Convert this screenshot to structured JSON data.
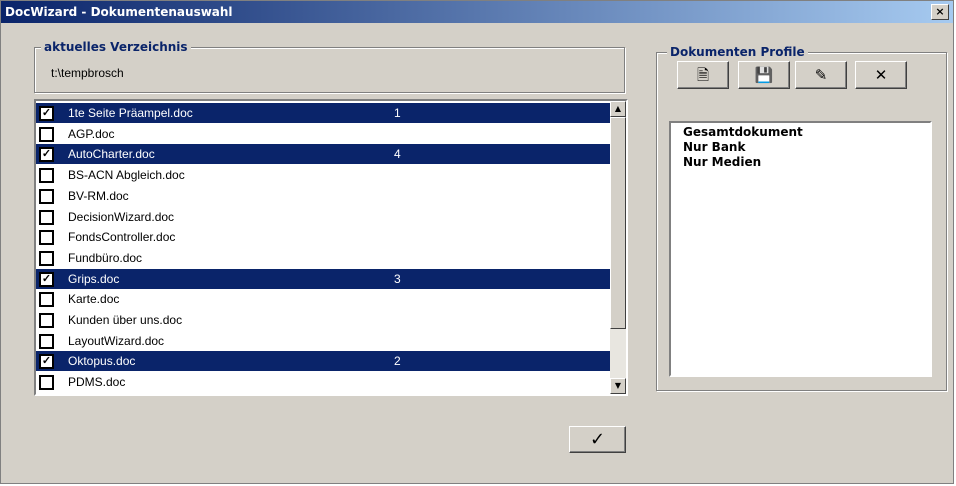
{
  "window": {
    "title": "DocWizard - Dokumentenauswahl",
    "close_label": "×"
  },
  "directory": {
    "legend": "aktuelles Verzeichnis",
    "path": "t:\\tempbrosch"
  },
  "documents": [
    {
      "name": "1te Seite Präampel.doc",
      "checked": true,
      "order": "1"
    },
    {
      "name": "AGP.doc",
      "checked": false,
      "order": ""
    },
    {
      "name": "AutoCharter.doc",
      "checked": true,
      "order": "4"
    },
    {
      "name": "BS-ACN Abgleich.doc",
      "checked": false,
      "order": ""
    },
    {
      "name": "BV-RM.doc",
      "checked": false,
      "order": ""
    },
    {
      "name": "DecisionWizard.doc",
      "checked": false,
      "order": ""
    },
    {
      "name": "FondsController.doc",
      "checked": false,
      "order": ""
    },
    {
      "name": "Fundbüro.doc",
      "checked": false,
      "order": ""
    },
    {
      "name": "Grips.doc",
      "checked": true,
      "order": "3"
    },
    {
      "name": "Karte.doc",
      "checked": false,
      "order": ""
    },
    {
      "name": "Kunden über uns.doc",
      "checked": false,
      "order": ""
    },
    {
      "name": "LayoutWizard.doc",
      "checked": false,
      "order": ""
    },
    {
      "name": "Oktopus.doc",
      "checked": true,
      "order": "2"
    },
    {
      "name": "PDMS.doc",
      "checked": false,
      "order": ""
    }
  ],
  "scroll": {
    "up_arrow": "▲",
    "down_arrow": "▼"
  },
  "profiles": {
    "legend": "Dokumenten Profile",
    "toolbar": [
      {
        "icon": "new-document-icon",
        "glyph": "🗎"
      },
      {
        "icon": "save-icon",
        "glyph": "💾"
      },
      {
        "icon": "edit-pencil-icon",
        "glyph": "✎"
      },
      {
        "icon": "delete-icon",
        "glyph": "✕"
      }
    ],
    "items": [
      "Gesamtdokument",
      "Nur Bank",
      "Nur Medien"
    ]
  },
  "ok_button": {
    "glyph": "✓"
  },
  "colors": {
    "selection": "#0a246a",
    "face": "#d4d0c8"
  }
}
